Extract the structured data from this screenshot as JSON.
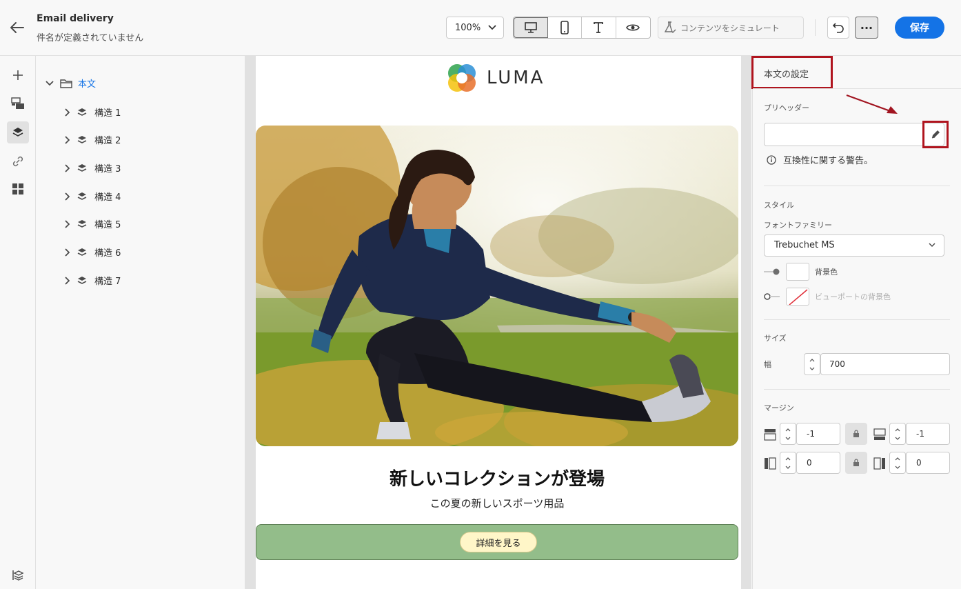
{
  "header": {
    "title": "Email delivery",
    "subtitle": "件名が定義されていません",
    "zoom": "100%",
    "simulate_label": "コンテンツをシミュレート",
    "save_label": "保存",
    "more_label": "···"
  },
  "tree": {
    "root_label": "本文",
    "items": [
      {
        "label": "構造 1"
      },
      {
        "label": "構造 2"
      },
      {
        "label": "構造 3"
      },
      {
        "label": "構造 4"
      },
      {
        "label": "構造 5"
      },
      {
        "label": "構造 6"
      },
      {
        "label": "構造 7"
      }
    ]
  },
  "email": {
    "logo_text": "LUMA",
    "headline": "新しいコレクションが登場",
    "subline": "この夏の新しいスポーツ用品",
    "cta_label": "詳細を見る"
  },
  "panel": {
    "title": "本文の設定",
    "preheader_label": "プリヘッダー",
    "preheader_value": "",
    "warning": "互換性に関する警告。",
    "style_label": "スタイル",
    "font_family_label": "フォントファミリー",
    "font_family_value": "Trebuchet MS",
    "bg_color_label": "背景色",
    "viewport_bg_label": "ビューポートの背景色",
    "size_label": "サイズ",
    "width_label": "幅",
    "width_value": "700",
    "margin_label": "マージン",
    "margin_top": "-1",
    "margin_bottom": "-1",
    "margin_left": "0",
    "margin_right": "0"
  },
  "colors": {
    "accent": "#1473e6",
    "highlight": "#b0141e",
    "cta_band": "#93bd8a",
    "cta_button": "#fff6c8"
  }
}
